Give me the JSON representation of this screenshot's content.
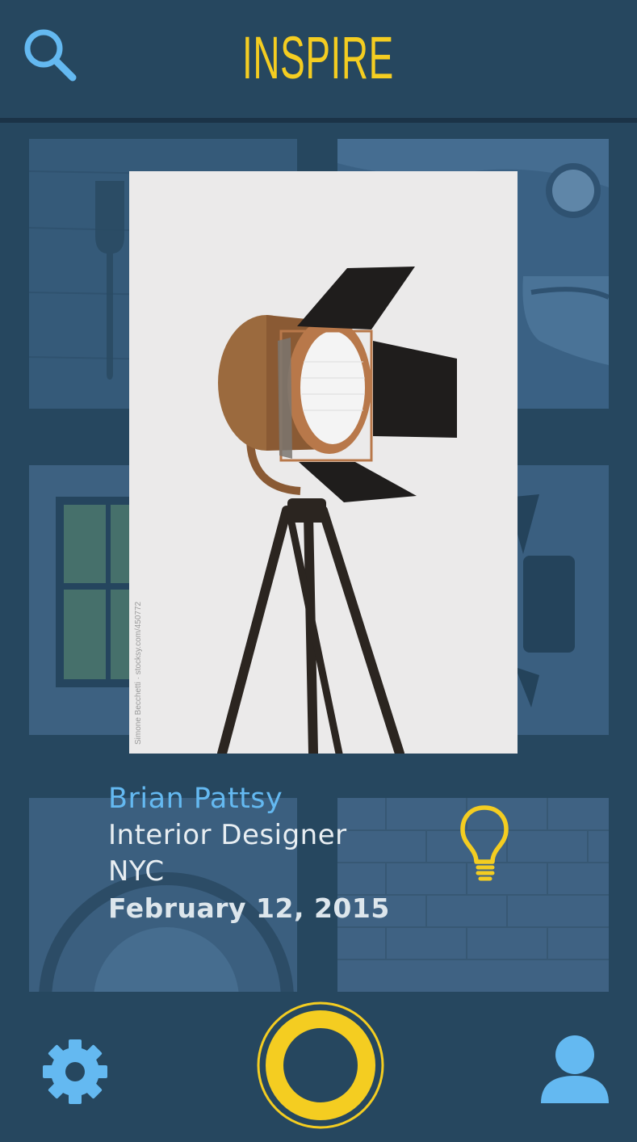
{
  "header": {
    "title": "INSPIRE",
    "search_icon": "search-icon"
  },
  "featured": {
    "image_subject": "tripod studio spotlight lamp",
    "photo_credit": "Simone Becchetti · stocksy.com/450772",
    "name": "Brian Pattsy",
    "role": "Interior Designer",
    "location": "NYC",
    "date": "February 12, 2015",
    "action_icon": "lightbulb-icon"
  },
  "bottom_bar": {
    "left_icon": "gear-icon",
    "center_icon": "record-ring-icon",
    "right_icon": "user-icon"
  },
  "colors": {
    "background": "#26475f",
    "accent_yellow": "#f4cd21",
    "accent_blue": "#64b9f1",
    "tile": "#34597a"
  }
}
